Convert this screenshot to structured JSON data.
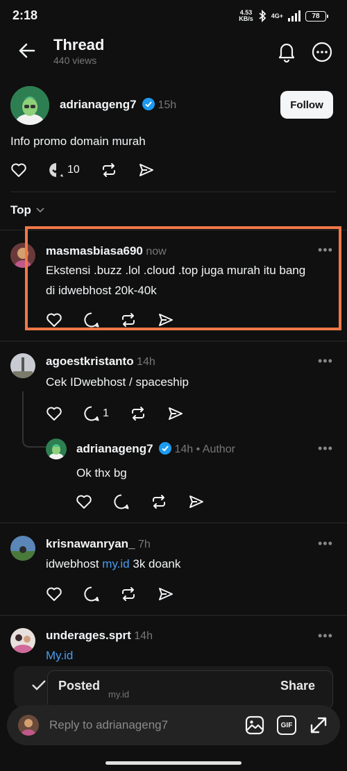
{
  "status_bar": {
    "time": "2:18",
    "net_speed_value": "4.53",
    "net_speed_unit": "KB/s",
    "network": "4G+",
    "battery": "78"
  },
  "header": {
    "title": "Thread",
    "views": "440 views"
  },
  "root_post": {
    "username": "adrianageng7",
    "time": "15h",
    "follow_label": "Follow",
    "text": "Info promo domain murah",
    "reply_count": "10"
  },
  "sort": {
    "label": "Top"
  },
  "replies": [
    {
      "username": "masmasbiasa690",
      "time": "now",
      "line1": "Ekstensi .buzz .lol .cloud .top juga murah itu bang",
      "line2": "di idwebhost 20k-40k"
    },
    {
      "username": "agoestkristanto",
      "time": "14h",
      "text": "Cek IDwebhost / spaceship",
      "reply_count": "1"
    },
    {
      "username": "adrianageng7",
      "time": "14h",
      "author_label": "• Author",
      "text": "Ok thx bg"
    },
    {
      "username": "krisnawanryan_",
      "time": "7h",
      "text_before": "idwebhost ",
      "link": "my.id",
      "text_after": " 3k doank"
    },
    {
      "username": "underages.sprt",
      "time": "14h",
      "link": "My.id"
    }
  ],
  "toast": {
    "posted": "Posted",
    "share": "Share",
    "preview": "my.id"
  },
  "reply_bar": {
    "placeholder": "Reply to adrianageng7",
    "gif": "GIF"
  },
  "colors": {
    "background": "#101010",
    "link": "#4a9cf0",
    "verified": "#1d9bf0",
    "highlight": "#f07848"
  }
}
